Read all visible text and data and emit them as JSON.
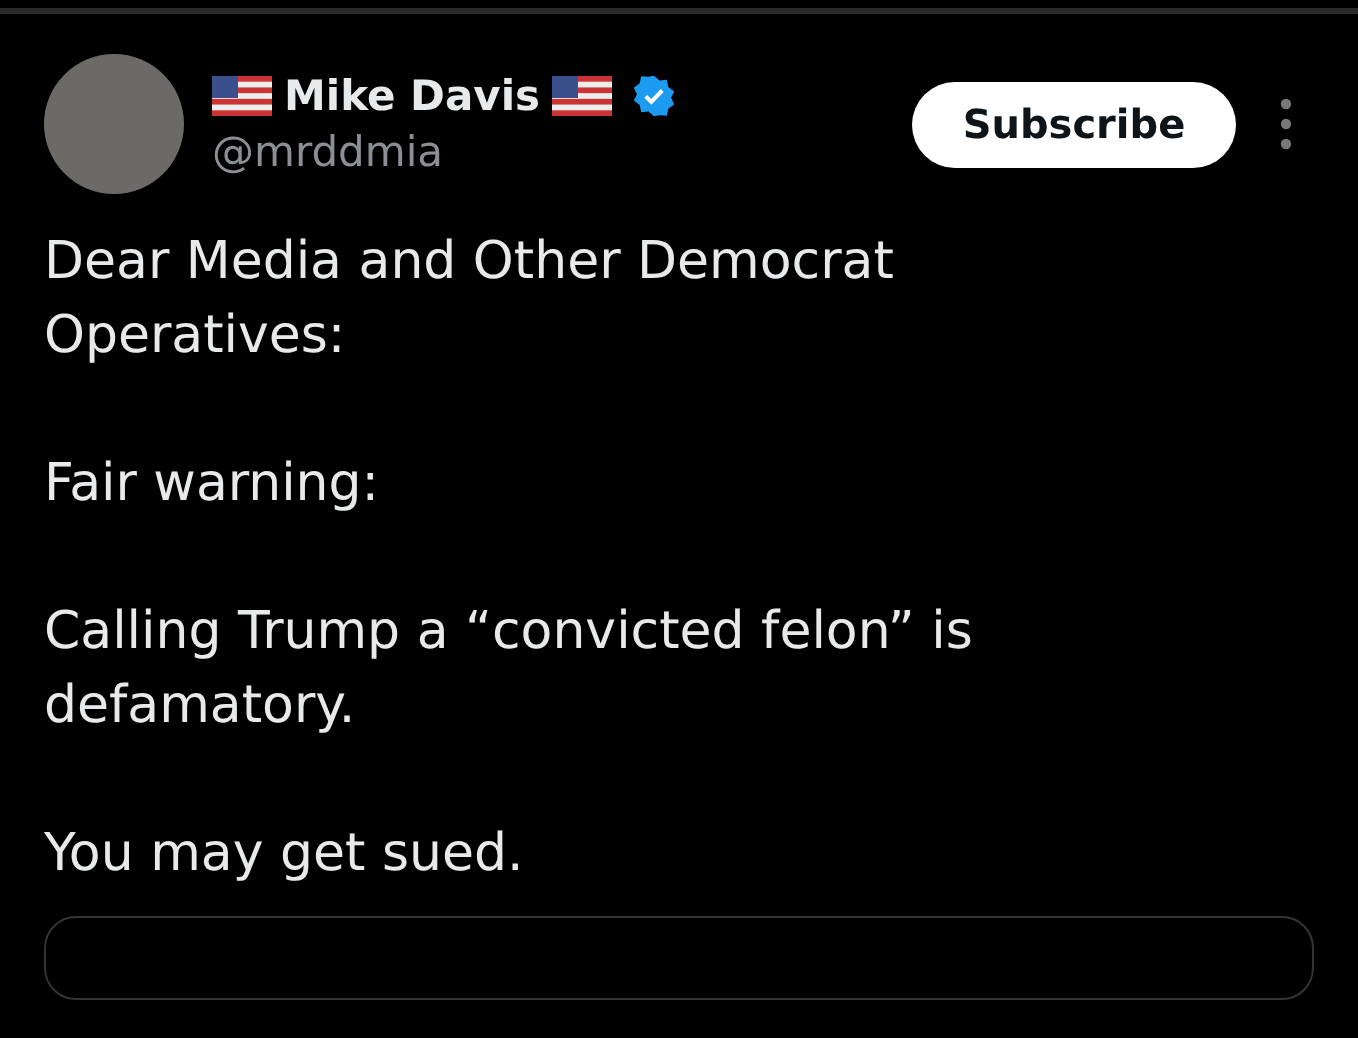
{
  "post": {
    "author_name": "Mike Davis",
    "handle": "@mrddmia",
    "verified": true,
    "subscribe_button": "Subscribe",
    "paragraphs": [
      "Dear Media and Other Democrat Operatives:",
      "Fair warning:",
      "Calling Trump a “convicted felon” is defamatory.",
      "You may get sued."
    ]
  }
}
